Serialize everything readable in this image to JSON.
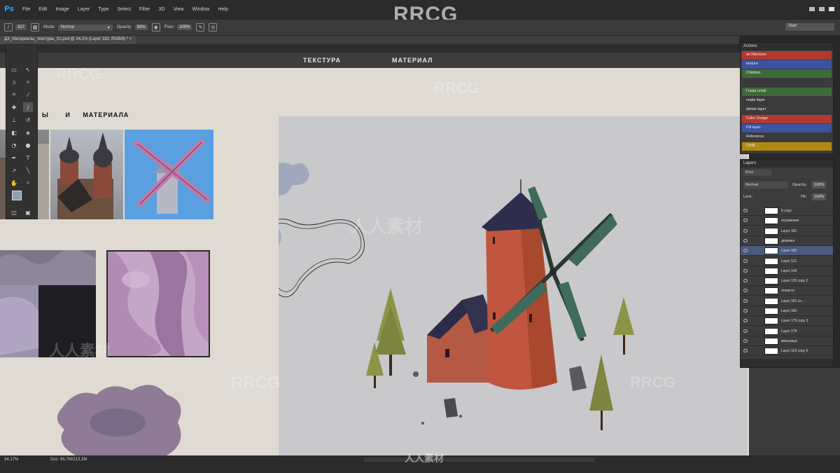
{
  "app": {
    "logo": "Ps",
    "watermark": "RRCG"
  },
  "menu": [
    "File",
    "Edit",
    "Image",
    "Layer",
    "Type",
    "Select",
    "Filter",
    "3D",
    "View",
    "Window",
    "Help"
  ],
  "options": {
    "brush_size": "317",
    "mode_label": "Mode:",
    "mode_value": "Normal",
    "opacity_label": "Opacity:",
    "opacity_value": "93%",
    "flow_label": "Flow:",
    "flow_value": "100%",
    "search_value": "Start"
  },
  "document": {
    "tab_title": "ДЗ_Материалы_текстуры_01.psd @ 34,1% (Layer 182, RGB/8) *"
  },
  "canvas": {
    "header_left": "ТЕКСТУРА",
    "header_right": "МАТЕРИАЛ",
    "section_title_prefix": "Ы",
    "section_title_and": "И",
    "section_title_word": "МАТЕРИАЛА"
  },
  "actions": {
    "title": "Actions",
    "items": [
      {
        "label": "architecture",
        "color": "#b03a30"
      },
      {
        "label": "texture",
        "color": "#3a54a0"
      },
      {
        "label": "Children",
        "color": "#3d6b38"
      },
      {
        "label": "",
        "color": "#3a3a3a"
      },
      {
        "label": "Глаза слой",
        "color": "#3d6b38"
      },
      {
        "label": "make layer",
        "color": "#3a3a3a"
      },
      {
        "label": "delete layer",
        "color": "#3a3a3a"
      },
      {
        "label": "Color Dodge",
        "color": "#b03a30"
      },
      {
        "label": "Fill layer",
        "color": "#3a54a0"
      },
      {
        "label": "Reference",
        "color": "#3a3a3a"
      },
      {
        "label": "CtrlN",
        "color": "#b08a10"
      }
    ]
  },
  "layers": {
    "title": "Layers",
    "kind_label": "Kind",
    "blend_mode": "Normal",
    "opacity_label": "Opacity:",
    "opacity_value": "100%",
    "lock_label": "Lock:",
    "fill_label": "Fill:",
    "fill_value": "100%",
    "rows": [
      {
        "name": "5 copy",
        "selected": false
      },
      {
        "name": "отражения",
        "selected": false
      },
      {
        "name": "Layer 181",
        "selected": false
      },
      {
        "name": "деревья",
        "selected": false
      },
      {
        "name": "Layer 182",
        "selected": true
      },
      {
        "name": "Layer 121",
        "selected": false
      },
      {
        "name": "Layer 149",
        "selected": false
      },
      {
        "name": "Layer 126 copy 2",
        "selected": false
      },
      {
        "name": "лопасти",
        "selected": false
      },
      {
        "name": "Layer 181 co...",
        "selected": false
      },
      {
        "name": "Layer 180",
        "selected": false
      },
      {
        "name": "Layer 179 copy 3",
        "selected": false
      },
      {
        "name": "Layer 178",
        "selected": false
      },
      {
        "name": "мельница",
        "selected": false
      },
      {
        "name": "Layer 103 copy 5",
        "selected": false
      }
    ]
  },
  "status": {
    "zoom": "34,17%",
    "doc_info": "Doc: 66,7M/213,3M"
  },
  "watermark_cn": "人人素材"
}
